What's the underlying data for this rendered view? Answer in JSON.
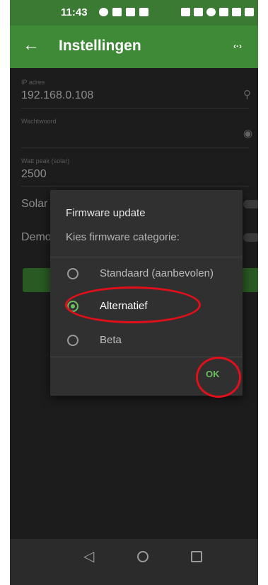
{
  "status_bar": {
    "time": "11:43"
  },
  "app_bar": {
    "title": "Instellingen",
    "back_icon": "←",
    "code_icon": "‹·›"
  },
  "settings": {
    "ip": {
      "label": "IP adres",
      "value": "192.168.0.108"
    },
    "password": {
      "label": "Wachtwoord",
      "value": ""
    },
    "watt_peak": {
      "label": "Watt peak (solar)",
      "value": "2500"
    },
    "solar_label": "Solar",
    "demo_label": "Demo"
  },
  "dialog": {
    "title": "Firmware update",
    "subtitle": "Kies firmware categorie:",
    "options": [
      {
        "label": "Standaard (aanbevolen)",
        "selected": false
      },
      {
        "label": "Alternatief",
        "selected": true
      },
      {
        "label": "Beta",
        "selected": false
      }
    ],
    "ok_label": "OK"
  },
  "colors": {
    "accent_green": "#3f8a36",
    "annotation_red": "#e10f1a"
  }
}
